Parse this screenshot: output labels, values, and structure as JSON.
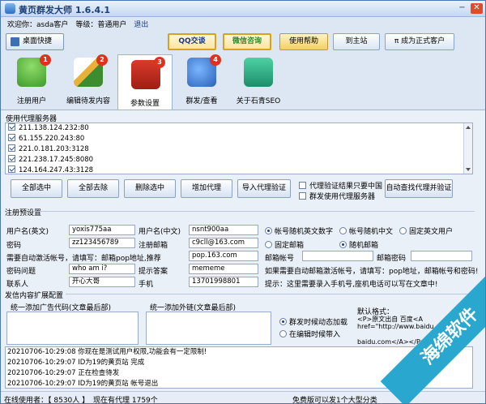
{
  "window": {
    "title": "黄页群发大师 1.6.4.1",
    "min": "−",
    "close": "✕"
  },
  "user": {
    "welcome": "欢迎你：asda客户",
    "level": "等级：普通用户",
    "logout": "退出"
  },
  "toolbar": {
    "desktop": "桌面快捷",
    "qq": "QQ交谈",
    "wechat": "微信咨询",
    "help": "使用帮助",
    "site": "到主站",
    "vip": "成为正式客户"
  },
  "nav": [
    {
      "label": "注册用户",
      "badge": "1"
    },
    {
      "label": "编辑待发内容",
      "badge": "2"
    },
    {
      "label": "参数设置",
      "badge": "3"
    },
    {
      "label": "群发/查看",
      "badge": "4"
    },
    {
      "label": "关于石青SEO",
      "badge": ""
    }
  ],
  "proxy": {
    "title": "使用代理服务器",
    "items": [
      "211.138.124.232:80",
      "61.155.220.243:80",
      "221.0.181.203:3128",
      "221.238.17.245:8080",
      "124.164.247.43:3128"
    ],
    "buttons": [
      "全部选中",
      "全部去除",
      "删除选中",
      "增加代理",
      "导入代理验证"
    ],
    "chk1": "代理验证结果只要中国",
    "chk2": "群发使用代理服务器",
    "auto": "自动查找代理并验证"
  },
  "reg": {
    "title": "注册预设置",
    "user_en_label": "用户名(英文)",
    "user_en": "yoxis775aa",
    "user_cn_label": "用户名(中文)",
    "user_cn": "nsnt900aa",
    "pwd_label": "密码",
    "pwd": "zz123456789",
    "email_label": "注册邮箱",
    "email": "c9cll@163.com",
    "r1": "帐号随机英文数字",
    "r2": "帐号随机中文",
    "r3": "固定英文用户",
    "r4": "固定邮箱",
    "r5": "随机邮箱",
    "need_label": "需要自动激活帐号，请填写：邮箱pop地址,推荐",
    "need_val": "pop.163.com",
    "mail_acc_label": "邮箱帐号",
    "mail_pwd_label": "邮箱密码",
    "q_label": "密码问题",
    "q": "who am i?",
    "a_label": "提示答案",
    "a": "mememe",
    "hint1": "如果需要自动邮箱激活帐号，请填写：pop地址，邮箱帐号和密码!",
    "contact_label": "联系人",
    "contact": "开心大哥",
    "phone_label": "手机",
    "phone": "13701998801",
    "hint2": "提示：这里需要录入手机号,座机电话可以写在文章中!"
  },
  "content": {
    "title": "发信内容扩展配置",
    "ad_label": "统一添加广告代码(文章最后部)",
    "link_label": "统一添加外链(文章最后部)",
    "r1": "群发时候动态加载",
    "r2": "在编辑时候带入",
    "fmt_title": "默认格式：",
    "fmt1": "<P>原文出自 百度<A",
    "fmt2": "href=\"http://www.baidu.com/",
    "fmt3": "baidu.com</A></P>"
  },
  "log": [
    "20210706-10:29:08  你现在是测试用户权限,功能会有一定限制!",
    "20210706-10:29:07  ID为19的黄页站 完成",
    "20210706-10:29:07  正在检查待发",
    "20210706-10:29:07  ID为19的黄页站 帐号退出"
  ],
  "status": {
    "user": "在线使用者：【 8530人 】",
    "proxy": "现在有代理 1759个",
    "free": "免费版可以发1个大型分类"
  },
  "watermark": "海绵软件"
}
